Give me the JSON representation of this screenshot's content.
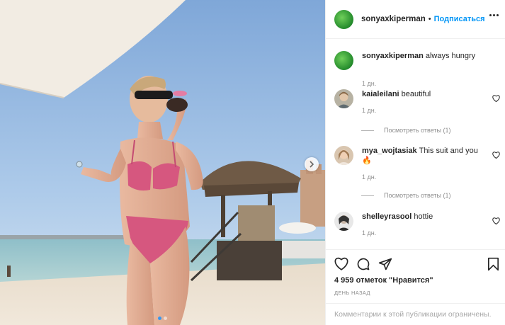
{
  "post": {
    "author": "sonyaxkiperman",
    "separator": "•",
    "follow_label": "Подписаться",
    "more_icon": "more-options-icon",
    "avatar_color": "#2f9a35"
  },
  "comments": [
    {
      "user": "sonyaxkiperman",
      "text": "always hungry",
      "time": "1 дн.",
      "avatar": "green"
    },
    {
      "user": "kaialeilani",
      "text": "beautiful",
      "time": "1 дн.",
      "avatar": "kaialeilani",
      "replies": "Посмотреть ответы (1)"
    },
    {
      "user": "mya_wojtasiak",
      "text": "This suit and you 🔥",
      "time": "1 дн.",
      "avatar": "mya",
      "replies": "Посмотреть ответы (1)"
    },
    {
      "user": "shelleyrasool",
      "text": "hottie",
      "time": "1 дн.",
      "avatar": "shelley"
    }
  ],
  "actions": {
    "likes": "4 959 отметок \"Нравится\"",
    "date": "ДЕНЬ НАЗАД",
    "icons": [
      "heart-icon",
      "comment-icon",
      "share-icon",
      "bookmark-icon"
    ]
  },
  "footer": {
    "text": "Комментарии к этой публикации ограничены."
  },
  "carousel": {
    "slides": 2,
    "active_slide": 1
  }
}
